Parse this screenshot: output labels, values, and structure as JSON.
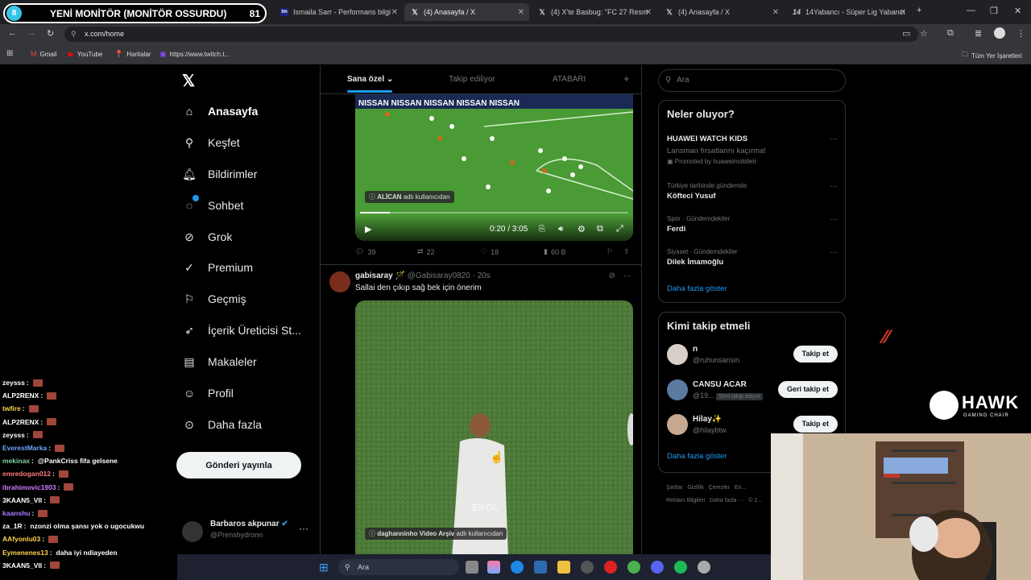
{
  "overlay": {
    "number": "8",
    "text": "YENİ MONİTÖR (MONİTÖR OSSURDU)",
    "count": "81"
  },
  "browser": {
    "tabs": [
      {
        "label": "Ismaila Sarr - Performans bilgi",
        "favicon": "tm-icon",
        "active": false
      },
      {
        "label": "(4) Anasayfa / X",
        "favicon": "x-icon",
        "active": true
      },
      {
        "label": "(4) X'te Basbug: \"FC 27 Resm",
        "favicon": "x-icon",
        "active": false
      },
      {
        "label": "(4) Anasayfa / X",
        "favicon": "x-icon",
        "active": false
      },
      {
        "label": "14Yabancı - Süper Lig Yabancı",
        "favicon": "14-icon",
        "active": false
      }
    ],
    "url": "x.com/home",
    "bookmarks": [
      {
        "label": "Gmail",
        "icon": "gmail-icon"
      },
      {
        "label": "YouTube",
        "icon": "youtube-icon"
      },
      {
        "label": "Haritalar",
        "icon": "maps-icon"
      },
      {
        "label": "https://www.twitch.t...",
        "icon": "twitch-icon"
      }
    ],
    "all_bookmarks": "Tüm Yer İşaretleri"
  },
  "nav": {
    "items": [
      {
        "label": "Anasayfa",
        "icon": "home-icon",
        "active": true
      },
      {
        "label": "Keşfet",
        "icon": "search-icon"
      },
      {
        "label": "Bildirimler",
        "icon": "bell-icon"
      },
      {
        "label": "Sohbet",
        "icon": "chat-icon"
      },
      {
        "label": "Grok",
        "icon": "grok-icon"
      },
      {
        "label": "Premium",
        "icon": "premium-icon"
      },
      {
        "label": "Geçmiş",
        "icon": "bookmark-icon"
      },
      {
        "label": "İçerik Üreticisi St...",
        "icon": "rocket-icon"
      },
      {
        "label": "Makaleler",
        "icon": "article-icon"
      },
      {
        "label": "Profil",
        "icon": "profile-icon"
      },
      {
        "label": "Daha fazla",
        "icon": "more-icon"
      }
    ],
    "post_button": "Gönderi yayınla",
    "profile": {
      "name": "Barbaros akpunar",
      "handle": "@Prenshydronn"
    }
  },
  "feed": {
    "tabs": [
      "Sana özel",
      "Takip ediliyor",
      "ATABARI"
    ],
    "tweet1": {
      "video_credit": "ALİCAN",
      "credit_suffix": "adlı kullanıcıdan",
      "time": "0:20 / 3:05",
      "progress": 0.11,
      "replies": "39",
      "retweets": "22",
      "likes": "18",
      "views": "60 B"
    },
    "tweet2": {
      "name": "gabisaray",
      "handle": "@Gabisaray0820",
      "age": "· 20s",
      "text": "Sallai den çıkıp sağ bek için önerim",
      "video_credit": "daghanninho Video Arşiv",
      "credit_suffix": "adlı kullanıcıdan",
      "watermark": "EKOL"
    }
  },
  "sidebar": {
    "search_placeholder": "Ara",
    "trends_title": "Neler oluyor?",
    "trends": [
      {
        "title": "HUAWEI WATCH KIDS",
        "subtitle": "Lansman fırsatlarını kaçırma!",
        "meta": "Promoted by huaweimobiletr"
      },
      {
        "meta": "Türkiye tarihinde gündemde",
        "title": "Köfteci Yusuf"
      },
      {
        "meta": "Spor · Gündemdekiler",
        "title": "Ferdi"
      },
      {
        "meta": "Siyaset · Gündemdekiler",
        "title": "Dilek İmamoğlu"
      }
    ],
    "show_more": "Daha fazla göster",
    "follow_title": "Kimi takip etmeli",
    "follows": [
      {
        "name": "n",
        "handle": "@ruhunsarisin",
        "button": "Takip et",
        "badge": ""
      },
      {
        "name": "CANSU ACAR",
        "handle": "@19...",
        "button": "Geri takip et",
        "badge": "Seni takip ediyor"
      },
      {
        "name": "Hilay✨",
        "handle": "@hilaybtw",
        "button": "Takip et",
        "badge": ""
      }
    ],
    "follow_more": "Daha fazla göster",
    "footer": [
      "Şartlar",
      "Gizlilik",
      "Çerezler",
      "Eri...",
      "Reklam Bilgileri",
      "Daha fazla ···",
      "© 2..."
    ]
  },
  "chat": [
    {
      "user": "zeysss",
      "msg": "",
      "color": "#ffffff"
    },
    {
      "user": "ALP2RENX",
      "msg": "",
      "color": "#ffffff"
    },
    {
      "user": "twfire",
      "msg": "",
      "color": "#ffd34d"
    },
    {
      "user": "ALP2RENX",
      "msg": "",
      "color": "#ffffff"
    },
    {
      "user": "zeysss",
      "msg": "",
      "color": "#ffffff"
    },
    {
      "user": "EverestMarka",
      "msg": "",
      "color": "#6aa8ff"
    },
    {
      "user": "mekinax",
      "msg": "@PankCriss fifa gelsene",
      "color": "#7fd3a0"
    },
    {
      "user": "emredogan012",
      "msg": "",
      "color": "#ff7b7b"
    },
    {
      "user": "ibrahimovic1903",
      "msg": "",
      "color": "#d07bff"
    },
    {
      "user": "3KAAN5_VII",
      "msg": "",
      "color": "#ffffff"
    },
    {
      "user": "kaanshu",
      "msg": "",
      "color": "#b07bff"
    },
    {
      "user": "za_1R",
      "msg": "nzonzi olma şansı yok o ugocukwu",
      "color": "#ffffff"
    },
    {
      "user": "AAfyonlu03",
      "msg": "",
      "color": "#ffd34d"
    },
    {
      "user": "Eymenenes13",
      "msg": "daha iyi ndiayeden",
      "color": "#ffd34d"
    },
    {
      "user": "3KAAN5_VII",
      "msg": "",
      "color": "#ffffff"
    }
  ],
  "taskbar": {
    "search": "Ara"
  },
  "brand": {
    "name": "HAWK",
    "tagline": "GAMING CHAIR"
  },
  "colors": {
    "accent": "#1d9bf0",
    "bg": "#000000",
    "border": "#2f3336"
  }
}
